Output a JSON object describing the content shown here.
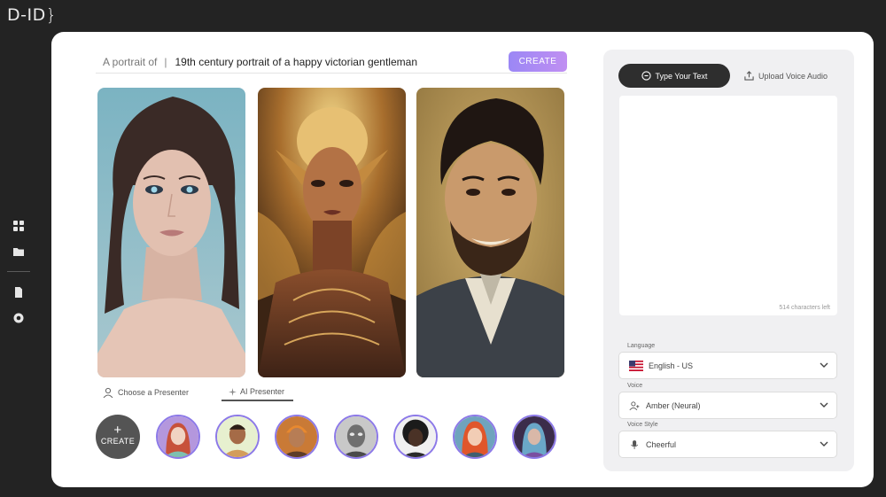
{
  "brand": {
    "logo_text": "D-ID",
    "logo_brace": "}"
  },
  "sidebar": {
    "items": [
      {
        "icon": "grid-icon"
      },
      {
        "icon": "folder-icon"
      },
      {
        "icon": "document-icon"
      },
      {
        "icon": "help-icon"
      }
    ]
  },
  "prompt": {
    "prefix": "A portrait of",
    "separator": "|",
    "value": "19th century portrait of a happy victorian gentleman",
    "create_label": "CREATE",
    "create_color_start": "#9b87f5",
    "create_color_end": "#c08ff2"
  },
  "portraits": [
    {
      "subject": "young woman with blue eyes, teal background"
    },
    {
      "subject": "golden ornate humanoid figure"
    },
    {
      "subject": "smiling bearded victorian gentleman"
    }
  ],
  "presenter_tabs": [
    {
      "label": "Choose a Presenter",
      "icon": "user-icon",
      "active": false
    },
    {
      "label": "AI Presenter",
      "icon": "sparkle-icon",
      "active": true
    }
  ],
  "avatars": {
    "create_label": "CREATE",
    "create_symbol": "+",
    "items": [
      {
        "subject": "red-haired illustrated woman"
      },
      {
        "subject": "illustrated man green background"
      },
      {
        "subject": "orange-haired man"
      },
      {
        "subject": "grey metallic figure"
      },
      {
        "subject": "woman with curly dark hair"
      },
      {
        "subject": "orange-haired woman"
      },
      {
        "subject": "blue-haired fantasy woman"
      }
    ]
  },
  "script_panel": {
    "tab_text": "Type Your Text",
    "tab_audio": "Upload Voice Audio",
    "text_value": "",
    "chars_left": "514 characters left",
    "language_label": "Language",
    "language_value": "English - US",
    "voice_label": "Voice",
    "voice_value": "Amber (Neural)",
    "voice_style_label": "Voice Style",
    "voice_style_value": "Cheerful"
  },
  "colors": {
    "background": "#232323",
    "card": "#ffffff",
    "panel": "#f0f0f2",
    "avatar_ring": "#8c79e8",
    "active_tab": "#2e2e2e"
  }
}
